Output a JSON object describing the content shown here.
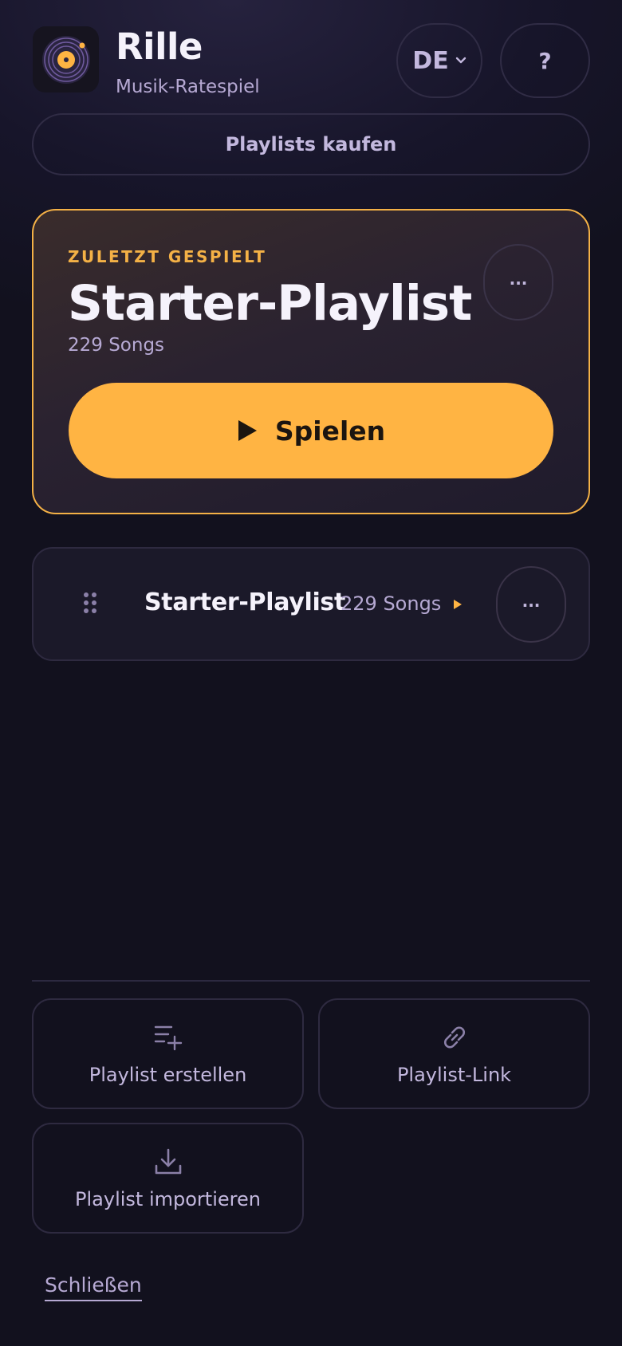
{
  "header": {
    "title": "Rille",
    "subtitle": "Musik-Ratespiel",
    "logo_icon": "vinyl-record-icon",
    "language": "DE",
    "help_label": "?",
    "buy_label": "Playlists kaufen"
  },
  "recent": {
    "label": "ZULETZT GESPIELT",
    "title": "Starter-Playlist",
    "count": "229 Songs",
    "more_label": "...",
    "play_label": "Spielen",
    "play_icon": "play-icon"
  },
  "playlists": [
    {
      "title": "Starter-Playlist",
      "count": "229 Songs",
      "more_label": "..."
    }
  ],
  "actions": {
    "create_label": "Playlist erstellen",
    "create_icon": "playlist-add-icon",
    "link_label": "Playlist-Link",
    "link_icon": "link-icon",
    "import_label": "Playlist importieren",
    "import_icon": "download-icon"
  },
  "footer": {
    "close_label": "Schließen"
  },
  "colors": {
    "accent": "#ffb443",
    "background": "#12111e",
    "muted_text": "#b6a9d3"
  }
}
